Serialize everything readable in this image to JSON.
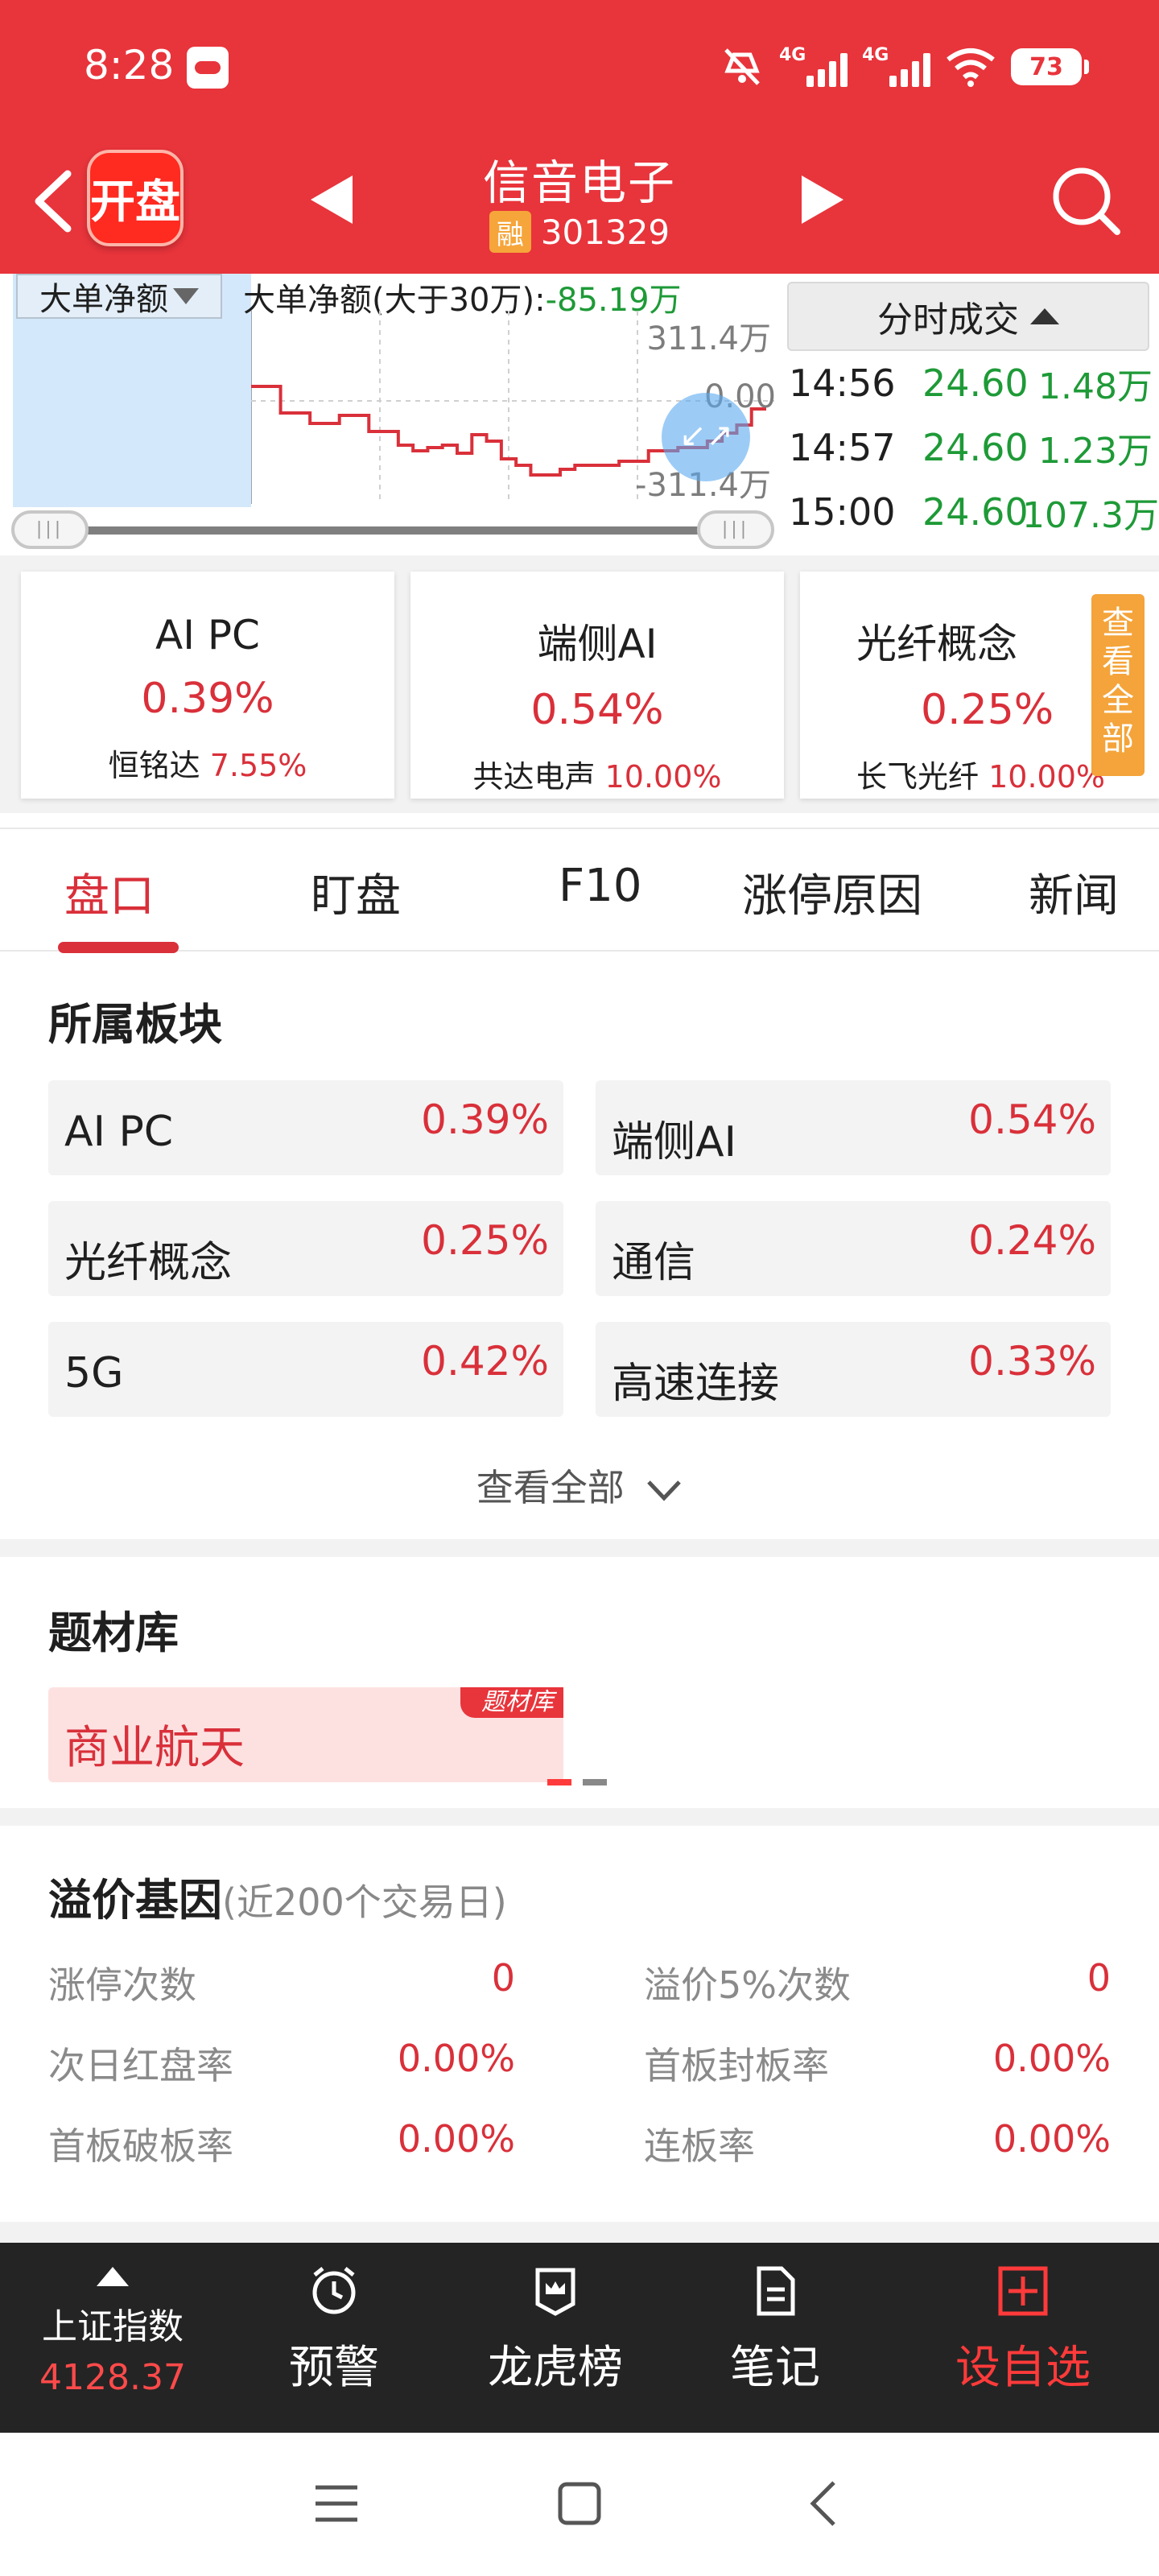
{
  "status_bar": {
    "time": "8:28",
    "net1": "4G",
    "net2": "4G",
    "battery": "73"
  },
  "header": {
    "logo_text": "开盘",
    "stock_name": "信音电子",
    "margin_badge": "融",
    "stock_code": "301329"
  },
  "chart": {
    "selector": "大单净额",
    "legend_label": "大单净额(大于30万):",
    "legend_value": "-85.19万",
    "axis_top": "311.4万",
    "axis_mid": "0.00",
    "axis_bottom": "-311.4万",
    "series_values": [
      0.18,
      0.18,
      -0.15,
      -0.15,
      -0.28,
      -0.28,
      -0.18,
      -0.18,
      -0.38,
      -0.38,
      -0.55,
      -0.62,
      -0.58,
      -0.55,
      -0.65,
      -0.42,
      -0.5,
      -0.72,
      -0.8,
      -0.92,
      -0.92,
      -0.85,
      -0.8,
      -0.8,
      -0.8,
      -0.75,
      -0.75,
      -0.62,
      -0.62,
      -0.58,
      -0.58,
      -0.5,
      -0.4,
      -0.3,
      -0.1,
      -0.1
    ]
  },
  "ticks": {
    "header": "分时成交",
    "rows": [
      {
        "time": "14:56",
        "price": "24.60",
        "vol": "1.48万"
      },
      {
        "time": "14:57",
        "price": "24.60",
        "vol": "1.23万"
      },
      {
        "time": "15:00",
        "price": "24.60",
        "vol": "107.3万"
      }
    ]
  },
  "concepts": [
    {
      "name": "AI PC",
      "pct": "0.39%",
      "leader": "恒铭达",
      "leader_pct": "7.55%"
    },
    {
      "name": "端侧AI",
      "pct": "0.54%",
      "leader": "共达电声",
      "leader_pct": "10.00%"
    },
    {
      "name": "光纤概念",
      "pct": "0.25%",
      "leader": "长飞光纤",
      "leader_pct": "10.00%"
    }
  ],
  "concepts_view_all": "查看全部",
  "tabs": [
    "盘口",
    "盯盘",
    "F10",
    "涨停原因",
    "新闻"
  ],
  "sectors": {
    "title": "所属板块",
    "items": [
      {
        "name": "AI PC",
        "pct": "0.39%"
      },
      {
        "name": "端侧AI",
        "pct": "0.54%"
      },
      {
        "name": "光纤概念",
        "pct": "0.25%"
      },
      {
        "name": "通信",
        "pct": "0.24%"
      },
      {
        "name": "5G",
        "pct": "0.42%"
      },
      {
        "name": "高速连接",
        "pct": "0.33%"
      }
    ],
    "view_all": "查看全部"
  },
  "themes": {
    "title": "题材库",
    "items": [
      {
        "name": "商业航天",
        "tag": "题材库"
      }
    ]
  },
  "premium_gene": {
    "title": "溢价基因",
    "subtitle": "(近200个交易日)",
    "stats": [
      {
        "label": "涨停次数",
        "value": "0"
      },
      {
        "label": "溢价5%次数",
        "value": "0"
      },
      {
        "label": "次日红盘率",
        "value": "0.00%"
      },
      {
        "label": "首板封板率",
        "value": "0.00%"
      },
      {
        "label": "首板破板率",
        "value": "0.00%"
      },
      {
        "label": "连板率",
        "value": "0.00%"
      }
    ]
  },
  "toolbar": {
    "index_name": "上证指数",
    "index_value": "4128.37",
    "items": [
      "预警",
      "龙虎榜",
      "笔记",
      "设自选"
    ]
  },
  "colors": {
    "brand_red": "#e8343b",
    "up_red": "#d9303a",
    "down_green": "#1e9a37",
    "tag_orange": "#f4a43a"
  }
}
